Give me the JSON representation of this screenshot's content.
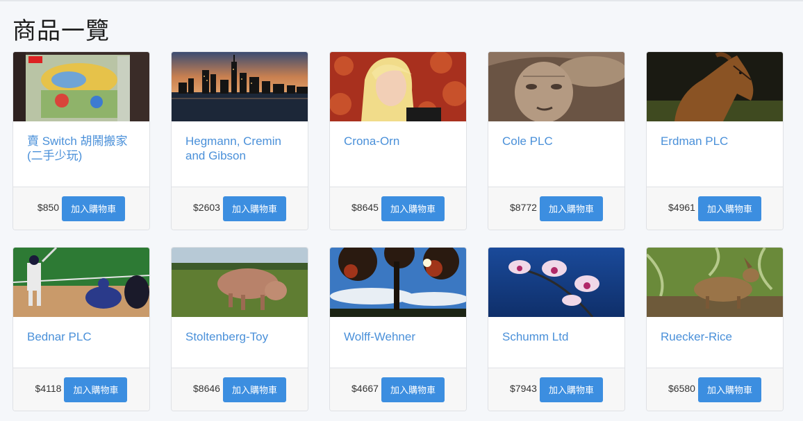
{
  "page": {
    "title": "商品一覽",
    "colors": {
      "accent": "#3c8ee0",
      "link": "#4a90d9",
      "background": "#f5f7fa"
    }
  },
  "products": [
    {
      "name": "賣 Switch 胡鬧搬家(二手少玩)",
      "price": "$850",
      "button_label": "加入購物車",
      "image": "game-box"
    },
    {
      "name": "Hegmann, Cremin and Gibson",
      "price": "$2603",
      "button_label": "加入購物車",
      "image": "city-skyline"
    },
    {
      "name": "Crona-Orn",
      "price": "$8645",
      "button_label": "加入購物車",
      "image": "blonde-woman"
    },
    {
      "name": "Cole PLC",
      "price": "$8772",
      "button_label": "加入購物車",
      "image": "old-man"
    },
    {
      "name": "Erdman PLC",
      "price": "$4961",
      "button_label": "加入購物車",
      "image": "horse"
    },
    {
      "name": "Bednar PLC",
      "price": "$4118",
      "button_label": "加入購物車",
      "image": "baseball"
    },
    {
      "name": "Stoltenberg-Toy",
      "price": "$8646",
      "button_label": "加入購物車",
      "image": "pig"
    },
    {
      "name": "Wolff-Wehner",
      "price": "$4667",
      "button_label": "加入購物車",
      "image": "tree-sky"
    },
    {
      "name": "Schumm Ltd",
      "price": "$7943",
      "button_label": "加入購物車",
      "image": "orchid"
    },
    {
      "name": "Ruecker-Rice",
      "price": "$6580",
      "button_label": "加入購物車",
      "image": "deer"
    }
  ]
}
